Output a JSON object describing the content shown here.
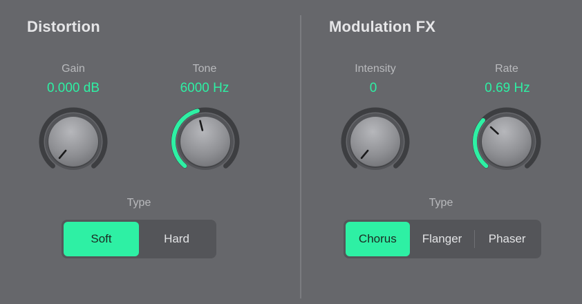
{
  "colors": {
    "accent": "#2ef0a4",
    "background": "#66676b",
    "label": "#b9babd"
  },
  "distortion": {
    "title": "Distortion",
    "gain": {
      "label": "Gain",
      "value": "0.000 dB",
      "level": 0.0
    },
    "tone": {
      "label": "Tone",
      "value": "6000 Hz",
      "level": 0.45
    },
    "type_label": "Type",
    "type_options": [
      {
        "label": "Soft",
        "selected": true
      },
      {
        "label": "Hard",
        "selected": false
      }
    ]
  },
  "modulation": {
    "title": "Modulation FX",
    "intensity": {
      "label": "Intensity",
      "value": "0",
      "level": 0.0
    },
    "rate": {
      "label": "Rate",
      "value": "0.69 Hz",
      "level": 0.33
    },
    "type_label": "Type",
    "type_options": [
      {
        "label": "Chorus",
        "selected": true
      },
      {
        "label": "Flanger",
        "selected": false
      },
      {
        "label": "Phaser",
        "selected": false
      }
    ]
  }
}
